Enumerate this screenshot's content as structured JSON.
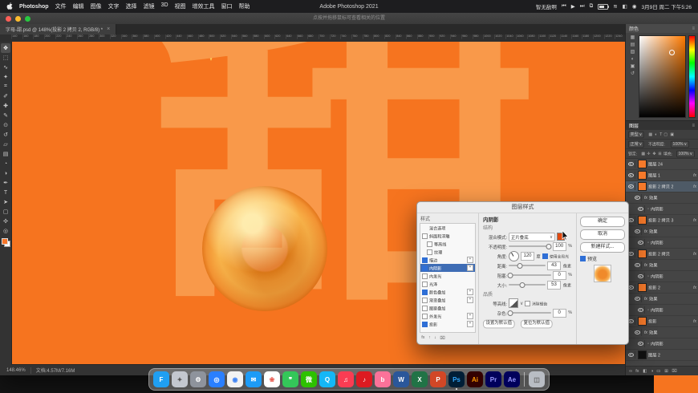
{
  "menubar": {
    "app_name": "Photoshop",
    "menus": [
      "文件",
      "编辑",
      "图像",
      "文字",
      "选择",
      "滤镜",
      "3D",
      "视图",
      "增效工具",
      "窗口",
      "帮助"
    ],
    "center_title": "Adobe Photoshop 2021",
    "song_title": "智无敌啊",
    "datetime": "3月9日 周二 下午5:26"
  },
  "window": {
    "hint_text": "点按并拖移鼠标可查看相关的位置",
    "doc_tab": "字母-甜.psd @ 148%(投影 2 拷贝 2, RGB/8) *",
    "status_zoom": "148.46%",
    "status_doc": "文档:4.57M/7.16M"
  },
  "ruler": {
    "start": 140,
    "end": 1260,
    "step": 20
  },
  "canvas": {
    "glyph": "甜",
    "bg": "#f6741f",
    "glyph_color": "#f9994a"
  },
  "tools": [
    {
      "name": "move-tool",
      "glyph": "✥"
    },
    {
      "name": "marquee-tool",
      "glyph": "⬚"
    },
    {
      "name": "lasso-tool",
      "glyph": "∿"
    },
    {
      "name": "quick-selection-tool",
      "glyph": "✦"
    },
    {
      "name": "crop-tool",
      "glyph": "⌗"
    },
    {
      "name": "eyedropper-tool",
      "glyph": "✐"
    },
    {
      "name": "healing-brush-tool",
      "glyph": "✚"
    },
    {
      "name": "brush-tool",
      "glyph": "✎"
    },
    {
      "name": "clone-stamp-tool",
      "glyph": "⊙"
    },
    {
      "name": "history-brush-tool",
      "glyph": "↺"
    },
    {
      "name": "eraser-tool",
      "glyph": "▱"
    },
    {
      "name": "gradient-tool",
      "glyph": "▤"
    },
    {
      "name": "blur-tool",
      "glyph": "◔"
    },
    {
      "name": "dodge-tool",
      "glyph": "◑"
    },
    {
      "name": "pen-tool",
      "glyph": "✒"
    },
    {
      "name": "type-tool",
      "glyph": "T"
    },
    {
      "name": "path-selection-tool",
      "glyph": "➤"
    },
    {
      "name": "shape-tool",
      "glyph": "▢"
    },
    {
      "name": "hand-tool",
      "glyph": "✣"
    },
    {
      "name": "zoom-tool",
      "glyph": "◎"
    }
  ],
  "dialog": {
    "title": "图层样式",
    "styles_header": "样式",
    "styles": [
      {
        "label": "混合选项",
        "checkbox": false,
        "checked": false,
        "plus": false
      },
      {
        "label": "斜面和浮雕",
        "checkbox": true,
        "checked": false,
        "plus": false
      },
      {
        "label": "等高线",
        "checkbox": true,
        "checked": false,
        "plus": false,
        "indent": true
      },
      {
        "label": "纹理",
        "checkbox": true,
        "checked": false,
        "plus": false,
        "indent": true
      },
      {
        "label": "描边",
        "checkbox": true,
        "checked": true,
        "plus": true
      },
      {
        "label": "内阴影",
        "checkbox": true,
        "checked": true,
        "plus": true,
        "selected": true
      },
      {
        "label": "内发光",
        "checkbox": true,
        "checked": false,
        "plus": false
      },
      {
        "label": "光泽",
        "checkbox": true,
        "checked": false,
        "plus": false
      },
      {
        "label": "颜色叠加",
        "checkbox": true,
        "checked": true,
        "plus": true
      },
      {
        "label": "渐变叠加",
        "checkbox": true,
        "checked": false,
        "plus": true
      },
      {
        "label": "图案叠加",
        "checkbox": true,
        "checked": false,
        "plus": false
      },
      {
        "label": "外发光",
        "checkbox": true,
        "checked": false,
        "plus": true
      },
      {
        "label": "投影",
        "checkbox": true,
        "checked": true,
        "plus": true
      }
    ],
    "footer_icons": [
      {
        "name": "add-effect-icon",
        "glyph": "fx"
      },
      {
        "name": "move-up-icon",
        "glyph": "↑"
      },
      {
        "name": "move-down-icon",
        "glyph": "↓"
      },
      {
        "name": "delete-effect-icon",
        "glyph": "⌧"
      }
    ],
    "section_title": "内阴影",
    "structure_label": "结构",
    "blend_mode_label": "混合模式:",
    "blend_mode_value": "正片叠底",
    "opacity_label": "不透明度:",
    "opacity_value": "100",
    "opacity_unit": "%",
    "angle_label": "角度:",
    "angle_value": "120",
    "angle_unit": "度",
    "global_light_label": "使用全局光",
    "distance_label": "距离:",
    "distance_value": "43",
    "distance_unit": "像素",
    "choke_label": "阻塞:",
    "choke_value": "0",
    "choke_unit": "%",
    "size_label": "大小:",
    "size_value": "53",
    "size_unit": "像素",
    "quality_label": "品质",
    "contour_label": "等高线:",
    "antialias_label": "消除锯齿",
    "noise_label": "杂色:",
    "noise_value": "0",
    "noise_unit": "%",
    "set_default_label": "设置为默认值",
    "reset_default_label": "复位为默认值",
    "ok_label": "确定",
    "cancel_label": "取消",
    "new_style_label": "新建样式...",
    "preview_label": "预览",
    "shadow_color": "#e2490f"
  },
  "panels": {
    "color_title": "颜色",
    "collapsed_icons": [
      {
        "name": "swatches-panel-icon",
        "glyph": "▦"
      },
      {
        "name": "gradients-panel-icon",
        "glyph": "▤"
      },
      {
        "name": "patterns-panel-icon",
        "glyph": "▨"
      },
      {
        "name": "adjustments-panel-icon",
        "glyph": "◐"
      },
      {
        "name": "libraries-panel-icon",
        "glyph": "▣"
      },
      {
        "name": "history-panel-icon",
        "glyph": "↺"
      }
    ],
    "layers": {
      "tab": "图层",
      "filter_label": "类型",
      "filter_icons": [
        {
          "name": "filter-pixel-icon",
          "glyph": "▦"
        },
        {
          "name": "filter-adjustment-icon",
          "glyph": "◐"
        },
        {
          "name": "filter-type-icon",
          "glyph": "T"
        },
        {
          "name": "filter-shape-icon",
          "glyph": "▢"
        },
        {
          "name": "filter-smart-object-icon",
          "glyph": "▣"
        }
      ],
      "blend_mode": "正常",
      "opacity_label": "不透明度:",
      "opacity_value": "100%",
      "lock_label": "锁定:",
      "lock_icons": [
        {
          "name": "lock-transparency-icon",
          "glyph": "▦"
        },
        {
          "name": "lock-pixels-icon",
          "glyph": "✛"
        },
        {
          "name": "lock-position-icon",
          "glyph": "✥"
        },
        {
          "name": "lock-all-icon",
          "glyph": "⊞"
        }
      ],
      "fill_label": "填充:",
      "fill_value": "100%",
      "rows": [
        {
          "name": "图层 24",
          "thumb": "orange"
        },
        {
          "name": "图层 1",
          "thumb": "orange",
          "fx": true
        },
        {
          "name": "投影 2 拷贝 2",
          "thumb": "orange",
          "fx": true,
          "selected": true
        },
        {
          "name": "效果",
          "kind": "fx-group"
        },
        {
          "name": "内阴影",
          "kind": "fx-item"
        },
        {
          "name": "投影 2 拷贝 3",
          "thumb": "orange",
          "fx": true
        },
        {
          "name": "效果",
          "kind": "fx-group"
        },
        {
          "name": "内阴影",
          "kind": "fx-item"
        },
        {
          "name": "投影 2 拷贝",
          "thumb": "orange",
          "fx": true
        },
        {
          "name": "效果",
          "kind": "fx-group"
        },
        {
          "name": "内阴影",
          "kind": "fx-item"
        },
        {
          "name": "投影 2",
          "thumb": "orange",
          "fx": true
        },
        {
          "name": "效果",
          "kind": "fx-group"
        },
        {
          "name": "内阴影",
          "kind": "fx-item"
        },
        {
          "name": "投影",
          "thumb": "orange",
          "fx": true
        },
        {
          "name": "效果",
          "kind": "fx-group"
        },
        {
          "name": "内阴影",
          "kind": "fx-item"
        },
        {
          "name": "图层 2",
          "thumb": "dark"
        }
      ],
      "footer_icons": [
        {
          "name": "link-layers-icon",
          "glyph": "∞"
        },
        {
          "name": "layer-style-icon",
          "glyph": "fx"
        },
        {
          "name": "layer-mask-icon",
          "glyph": "◧"
        },
        {
          "name": "adjustment-layer-icon",
          "glyph": "◑"
        },
        {
          "name": "layer-group-icon",
          "glyph": "▭"
        },
        {
          "name": "new-layer-icon",
          "glyph": "⊞"
        },
        {
          "name": "delete-layer-icon",
          "glyph": "⌧"
        }
      ]
    }
  },
  "dock": [
    {
      "name": "finder",
      "glyph": "F",
      "bg": "#1f9ff3"
    },
    {
      "name": "launchpad",
      "glyph": "✦",
      "bg": "#c3c7cf",
      "fg": "#555555"
    },
    {
      "name": "system-preferences",
      "glyph": "⚙",
      "bg": "#8e939c"
    },
    {
      "name": "safari",
      "glyph": "◎",
      "bg": "#2a7fff"
    },
    {
      "name": "chrome",
      "glyph": "◉",
      "bg": "#f2f2f2",
      "fg": "#4285f4"
    },
    {
      "name": "mail",
      "glyph": "✉",
      "bg": "#1d9bf6"
    },
    {
      "name": "photos",
      "glyph": "❀",
      "bg": "#ffffff",
      "fg": "#e8564b"
    },
    {
      "name": "messages",
      "glyph": "❞",
      "bg": "#34c759"
    },
    {
      "name": "wechat",
      "glyph": "微",
      "bg": "#2dc100"
    },
    {
      "name": "qq",
      "glyph": "Q",
      "bg": "#14b7f6"
    },
    {
      "name": "music",
      "glyph": "♫",
      "bg": "#fb3c53"
    },
    {
      "name": "netease-music",
      "glyph": "♪",
      "bg": "#dd1a21"
    },
    {
      "name": "bilibili",
      "glyph": "b",
      "bg": "#fb7299"
    },
    {
      "name": "word",
      "glyph": "W",
      "bg": "#2b579a"
    },
    {
      "name": "excel",
      "glyph": "X",
      "bg": "#217346"
    },
    {
      "name": "powerpoint",
      "glyph": "P",
      "bg": "#d24726"
    },
    {
      "name": "photoshop",
      "glyph": "Ps",
      "bg": "#001e36",
      "fg": "#31a8ff",
      "running": true
    },
    {
      "name": "illustrator",
      "glyph": "Ai",
      "bg": "#330000",
      "fg": "#ff9a00"
    },
    {
      "name": "premiere",
      "glyph": "Pr",
      "bg": "#00005b",
      "fg": "#9999ff"
    },
    {
      "name": "after-effects",
      "glyph": "Ae",
      "bg": "#00005b",
      "fg": "#9999ff"
    },
    {
      "separator": true
    },
    {
      "name": "trash",
      "glyph": "◫",
      "bg": "#b9bdc4",
      "fg": "#666666"
    }
  ]
}
